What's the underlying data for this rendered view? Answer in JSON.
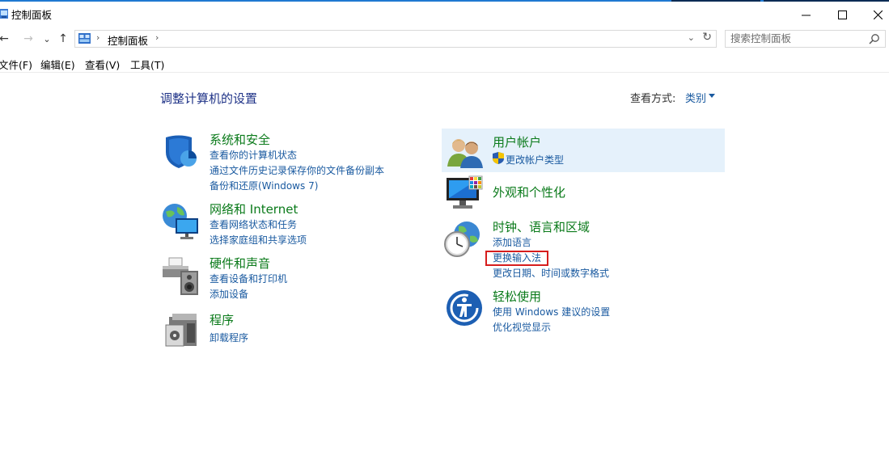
{
  "window": {
    "title": "控制面板",
    "minimize_glyph": "─",
    "maximize_glyph": "☐",
    "close_glyph": "✕"
  },
  "nav": {
    "back_glyph": "←",
    "forward_glyph": "→",
    "recent_glyph": "⌄",
    "up_glyph": "↑",
    "breadcrumb": "控制面板",
    "refresh_glyph": "↻"
  },
  "search": {
    "placeholder": "搜索控制面板"
  },
  "menubar": {
    "file": "文件(F)",
    "edit": "编辑(E)",
    "view": "查看(V)",
    "tools": "工具(T)"
  },
  "main": {
    "heading": "调整计算机的设置",
    "view_by_label": "查看方式:",
    "view_by_value": "类别"
  },
  "categories": {
    "system": {
      "title": "系统和安全",
      "links": [
        "查看你的计算机状态",
        "通过文件历史记录保存你的文件备份副本",
        "备份和还原(Windows 7)"
      ]
    },
    "network": {
      "title": "网络和 Internet",
      "links": [
        "查看网络状态和任务",
        "选择家庭组和共享选项"
      ]
    },
    "hardware": {
      "title": "硬件和声音",
      "links": [
        "查看设备和打印机",
        "添加设备"
      ]
    },
    "programs": {
      "title": "程序",
      "links": [
        "卸载程序"
      ]
    },
    "users": {
      "title": "用户帐户",
      "links": [
        "更改帐户类型"
      ]
    },
    "appearance": {
      "title": "外观和个性化",
      "links": []
    },
    "clock": {
      "title": "时钟、语言和区域",
      "links": [
        "添加语言",
        "更换输入法",
        "更改日期、时间或数字格式"
      ]
    },
    "ease": {
      "title": "轻松使用",
      "links": [
        "使用 Windows 建议的设置",
        "优化视觉显示"
      ]
    }
  },
  "colors": {
    "category_title": "#0a7a1a",
    "link": "#1a5aa0",
    "highlight_box": "#d61d1d",
    "selected_bg": "#e5f1fb"
  },
  "icons": {
    "title": "control-panel-icon",
    "system": "shield-icon",
    "network": "globe-monitor-icon",
    "hardware": "printer-speaker-icon",
    "programs": "programs-box-icon",
    "users": "users-icon",
    "appearance": "monitor-palette-icon",
    "clock": "globe-clock-icon",
    "ease": "accessibility-icon"
  }
}
